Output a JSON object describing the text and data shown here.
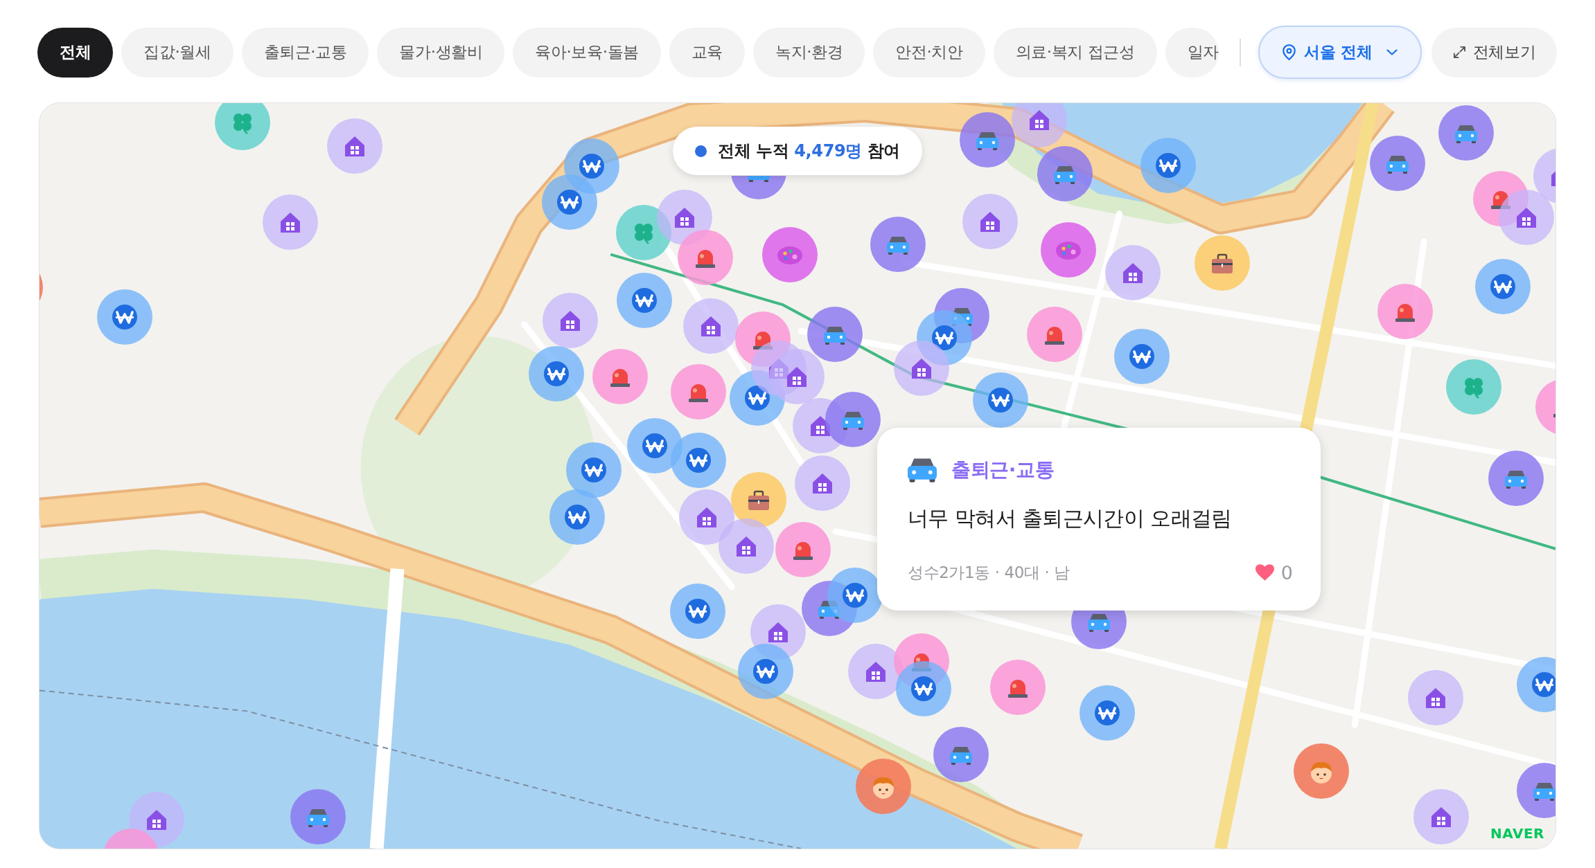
{
  "filters": [
    {
      "label": "전체",
      "selected": true
    },
    {
      "label": "집값·월세",
      "selected": false
    },
    {
      "label": "출퇴근·교통",
      "selected": false
    },
    {
      "label": "물가·생활비",
      "selected": false
    },
    {
      "label": "육아·보육·돌봄",
      "selected": false
    },
    {
      "label": "교육",
      "selected": false
    },
    {
      "label": "녹지·환경",
      "selected": false
    },
    {
      "label": "안전·치안",
      "selected": false
    },
    {
      "label": "의료·복지 접근성",
      "selected": false
    },
    {
      "label": "일자",
      "selected": false
    }
  ],
  "region_select": {
    "value": "서울 전체"
  },
  "fullscreen_button": {
    "label": "전체보기"
  },
  "map": {
    "summary": {
      "prefix": "전체 누적",
      "count": "4,479명",
      "suffix": "참여"
    },
    "markers": [
      {
        "kind": "clover"
      },
      {
        "kind": "house"
      },
      {
        "kind": "house"
      },
      {
        "kind": "child"
      },
      {
        "kind": "won"
      },
      {
        "kind": "car"
      },
      {
        "kind": "won"
      },
      {
        "kind": "won"
      },
      {
        "kind": "clover"
      },
      {
        "kind": "house"
      },
      {
        "kind": "siren"
      },
      {
        "kind": "palette"
      },
      {
        "kind": "car"
      },
      {
        "kind": "car"
      },
      {
        "kind": "house"
      },
      {
        "kind": "car"
      },
      {
        "kind": "won"
      },
      {
        "kind": "car"
      },
      {
        "kind": "car"
      },
      {
        "kind": "siren"
      },
      {
        "kind": "house"
      },
      {
        "kind": "house"
      },
      {
        "kind": "house"
      },
      {
        "kind": "palette"
      },
      {
        "kind": "house"
      },
      {
        "kind": "briefcase"
      },
      {
        "kind": "won"
      },
      {
        "kind": "siren"
      },
      {
        "kind": "won"
      },
      {
        "kind": "house"
      },
      {
        "kind": "house"
      },
      {
        "kind": "siren"
      },
      {
        "kind": "car"
      },
      {
        "kind": "car"
      },
      {
        "kind": "won"
      },
      {
        "kind": "siren"
      },
      {
        "kind": "won"
      },
      {
        "kind": "house"
      },
      {
        "kind": "won"
      },
      {
        "kind": "siren"
      },
      {
        "kind": "siren"
      },
      {
        "kind": "won"
      },
      {
        "kind": "house"
      },
      {
        "kind": "house"
      },
      {
        "kind": "house"
      },
      {
        "kind": "car"
      },
      {
        "kind": "won"
      },
      {
        "kind": "clover"
      },
      {
        "kind": "won"
      },
      {
        "kind": "won"
      },
      {
        "kind": "won"
      },
      {
        "kind": "house"
      },
      {
        "kind": "briefcase"
      },
      {
        "kind": "won"
      },
      {
        "kind": "house"
      },
      {
        "kind": "house"
      },
      {
        "kind": "siren"
      },
      {
        "kind": "car"
      },
      {
        "kind": "won"
      },
      {
        "kind": "house"
      },
      {
        "kind": "car"
      },
      {
        "kind": "won"
      },
      {
        "kind": "car"
      },
      {
        "kind": "won"
      },
      {
        "kind": "house"
      },
      {
        "kind": "siren"
      },
      {
        "kind": "won"
      },
      {
        "kind": "siren"
      },
      {
        "kind": "won"
      },
      {
        "kind": "car"
      },
      {
        "kind": "child"
      },
      {
        "kind": "child"
      },
      {
        "kind": "house"
      },
      {
        "kind": "won"
      },
      {
        "kind": "car"
      },
      {
        "kind": "house"
      },
      {
        "kind": "car"
      },
      {
        "kind": "house"
      },
      {
        "kind": "siren"
      },
      {
        "kind": "siren"
      }
    ],
    "popup": {
      "category": {
        "kind": "car",
        "label": "출퇴근·교통"
      },
      "comment": "너무 막혀서 출퇴근시간이 오래걸림",
      "meta": "성수2가1동 · 40대 · 남",
      "likes": "0"
    },
    "attribution": "NAVER"
  }
}
